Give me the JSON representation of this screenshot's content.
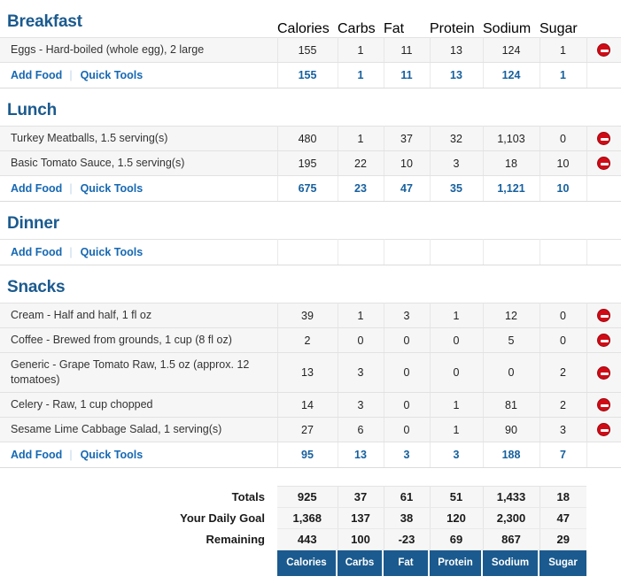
{
  "columns": [
    "Calories",
    "Carbs",
    "Fat",
    "Protein",
    "Sodium",
    "Sugar"
  ],
  "links": {
    "add_food": "Add Food",
    "quick_tools": "Quick Tools",
    "separator": "|"
  },
  "icons": {
    "remove": "remove-circle-icon"
  },
  "colors": {
    "header_blue": "#1B5A8E",
    "link_blue": "#1668B3",
    "positive_green": "#1B7D1B",
    "negative_red": "#F0000E",
    "row_gray": "#F6F6F6",
    "remove_red": "#D00B15"
  },
  "sections": [
    {
      "title": "Breakfast",
      "foods": [
        {
          "name": "Eggs - Hard-boiled (whole egg), 2 large",
          "calories": "155",
          "carbs": "1",
          "fat": "11",
          "protein": "13",
          "sodium": "124",
          "sugar": "1"
        }
      ],
      "totals": {
        "calories": "155",
        "carbs": "1",
        "fat": "11",
        "protein": "13",
        "sodium": "124",
        "sugar": "1"
      }
    },
    {
      "title": "Lunch",
      "foods": [
        {
          "name": "Turkey Meatballs, 1.5 serving(s)",
          "calories": "480",
          "carbs": "1",
          "fat": "37",
          "protein": "32",
          "sodium": "1,103",
          "sugar": "0"
        },
        {
          "name": "Basic Tomato Sauce, 1.5 serving(s)",
          "calories": "195",
          "carbs": "22",
          "fat": "10",
          "protein": "3",
          "sodium": "18",
          "sugar": "10"
        }
      ],
      "totals": {
        "calories": "675",
        "carbs": "23",
        "fat": "47",
        "protein": "35",
        "sodium": "1,121",
        "sugar": "10"
      }
    },
    {
      "title": "Dinner",
      "foods": [],
      "totals": {
        "calories": "",
        "carbs": "",
        "fat": "",
        "protein": "",
        "sodium": "",
        "sugar": ""
      }
    },
    {
      "title": "Snacks",
      "foods": [
        {
          "name": "Cream - Half and half, 1 fl oz",
          "calories": "39",
          "carbs": "1",
          "fat": "3",
          "protein": "1",
          "sodium": "12",
          "sugar": "0"
        },
        {
          "name": "Coffee - Brewed from grounds, 1 cup (8 fl oz)",
          "calories": "2",
          "carbs": "0",
          "fat": "0",
          "protein": "0",
          "sodium": "5",
          "sugar": "0"
        },
        {
          "name": "Generic - Grape Tomato Raw, 1.5 oz (approx. 12 tomatoes)",
          "calories": "13",
          "carbs": "3",
          "fat": "0",
          "protein": "0",
          "sodium": "0",
          "sugar": "2"
        },
        {
          "name": "Celery - Raw, 1 cup chopped",
          "calories": "14",
          "carbs": "3",
          "fat": "0",
          "protein": "1",
          "sodium": "81",
          "sugar": "2"
        },
        {
          "name": "Sesame Lime Cabbage Salad, 1 serving(s)",
          "calories": "27",
          "carbs": "6",
          "fat": "0",
          "protein": "1",
          "sodium": "90",
          "sugar": "3"
        }
      ],
      "totals": {
        "calories": "95",
        "carbs": "13",
        "fat": "3",
        "protein": "3",
        "sodium": "188",
        "sugar": "7"
      }
    }
  ],
  "summary": {
    "rows": [
      {
        "label": "Totals",
        "style": "plain",
        "values": {
          "calories": "925",
          "carbs": "37",
          "fat": "61",
          "protein": "51",
          "sodium": "1,433",
          "sugar": "18"
        }
      },
      {
        "label": "Your Daily Goal",
        "style": "plain",
        "values": {
          "calories": "1,368",
          "carbs": "137",
          "fat": "38",
          "protein": "120",
          "sodium": "2,300",
          "sugar": "47"
        }
      },
      {
        "label": "Remaining",
        "style": "signed",
        "values": {
          "calories": "443",
          "carbs": "100",
          "fat": "-23",
          "protein": "69",
          "sodium": "867",
          "sugar": "29"
        }
      }
    ]
  }
}
